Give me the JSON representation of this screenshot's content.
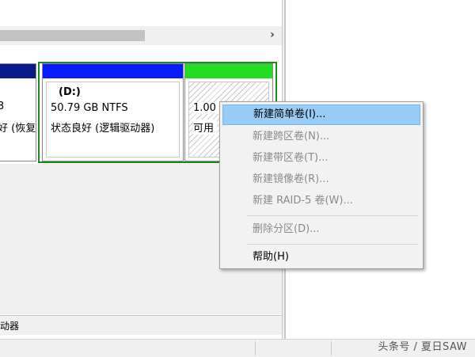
{
  "scrollbar": {
    "right_arrow": "›"
  },
  "disk": {
    "left_segment": {
      "line1": "3",
      "line2": "好 (恢复"
    },
    "d_partition": {
      "name": "(D:)",
      "size": "50.79 GB NTFS",
      "status": "状态良好 (逻辑驱动器)"
    },
    "free_space": {
      "size": "1.00",
      "status": "可用"
    }
  },
  "legend": {
    "text": "动器"
  },
  "context_menu": {
    "items": [
      {
        "label": "新建简单卷(I)...",
        "enabled": true,
        "highlighted": true
      },
      {
        "label": "新建跨区卷(N)...",
        "enabled": false
      },
      {
        "label": "新建带区卷(T)...",
        "enabled": false
      },
      {
        "label": "新建镜像卷(R)...",
        "enabled": false
      },
      {
        "label": "新建 RAID-5 卷(W)...",
        "enabled": false
      },
      {
        "label": "删除分区(D)...",
        "enabled": false
      },
      {
        "label": "帮助(H)",
        "enabled": true
      }
    ]
  },
  "watermark": "头条号 / 夏日SAW",
  "colors": {
    "primary_partition_bar": "#0a1a8a",
    "logical_partition_bar": "#0a1aff",
    "free_space_bar": "#22dd22",
    "extended_partition_border": "#1c8a1c",
    "menu_highlight": "#99ccf5"
  }
}
